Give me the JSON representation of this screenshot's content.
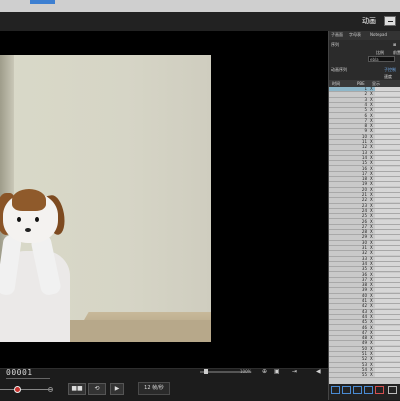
{
  "header": {
    "title": "动画",
    "minimize_label": "—"
  },
  "panel": {
    "tabs": [
      "子画面",
      "字母表",
      "Notepad"
    ],
    "row1": "序列",
    "label_a": "比例",
    "label_b": "前置",
    "field_value": "ebla",
    "sequence_label": "动画序列",
    "side_a": "子控制",
    "side_b": "速度",
    "grid_headers": [
      "时间",
      "PBE",
      "显示"
    ],
    "rows": [
      {
        "n": "1",
        "x": "X"
      },
      {
        "n": "2",
        "x": "X"
      },
      {
        "n": "3",
        "x": "X"
      },
      {
        "n": "4",
        "x": "X"
      },
      {
        "n": "5",
        "x": "X"
      },
      {
        "n": "6",
        "x": "X"
      },
      {
        "n": "7",
        "x": "X"
      },
      {
        "n": "8",
        "x": "X"
      },
      {
        "n": "9",
        "x": "X"
      },
      {
        "n": "10",
        "x": "X"
      },
      {
        "n": "11",
        "x": "X"
      },
      {
        "n": "12",
        "x": "X"
      },
      {
        "n": "13",
        "x": "X"
      },
      {
        "n": "14",
        "x": "X"
      },
      {
        "n": "15",
        "x": "X"
      },
      {
        "n": "16",
        "x": "X"
      },
      {
        "n": "17",
        "x": "X"
      },
      {
        "n": "18",
        "x": "X"
      },
      {
        "n": "19",
        "x": "X"
      },
      {
        "n": "20",
        "x": "X"
      },
      {
        "n": "21",
        "x": "X"
      },
      {
        "n": "22",
        "x": "X"
      },
      {
        "n": "23",
        "x": "X"
      },
      {
        "n": "24",
        "x": "X"
      },
      {
        "n": "25",
        "x": "X"
      },
      {
        "n": "26",
        "x": "X"
      },
      {
        "n": "27",
        "x": "X"
      },
      {
        "n": "28",
        "x": "X"
      },
      {
        "n": "29",
        "x": "X"
      },
      {
        "n": "30",
        "x": "X"
      },
      {
        "n": "31",
        "x": "X"
      },
      {
        "n": "32",
        "x": "X"
      },
      {
        "n": "33",
        "x": "X"
      },
      {
        "n": "34",
        "x": "X"
      },
      {
        "n": "35",
        "x": "X"
      },
      {
        "n": "36",
        "x": "X"
      },
      {
        "n": "37",
        "x": "X"
      },
      {
        "n": "38",
        "x": "X"
      },
      {
        "n": "39",
        "x": "X"
      },
      {
        "n": "40",
        "x": "X"
      },
      {
        "n": "41",
        "x": "X"
      },
      {
        "n": "42",
        "x": "X"
      },
      {
        "n": "43",
        "x": "X"
      },
      {
        "n": "44",
        "x": "X"
      },
      {
        "n": "45",
        "x": "X"
      },
      {
        "n": "46",
        "x": "X"
      },
      {
        "n": "47",
        "x": "X"
      },
      {
        "n": "48",
        "x": "X"
      },
      {
        "n": "49",
        "x": "X"
      },
      {
        "n": "50",
        "x": "X"
      },
      {
        "n": "51",
        "x": "X"
      },
      {
        "n": "52",
        "x": "X"
      },
      {
        "n": "53",
        "x": "X"
      },
      {
        "n": "54",
        "x": "X"
      },
      {
        "n": "55",
        "x": "X"
      }
    ],
    "selected_row": 0
  },
  "controls": {
    "timecode": "00001",
    "zoom_label": "100%",
    "fps_label": "12 帧/秒",
    "buttons": [
      "■■",
      "⟲",
      "▶"
    ]
  },
  "colors": {
    "accent": "#3d7fd1",
    "playhead": "#c8332f",
    "selection": "#8eb7c9"
  }
}
